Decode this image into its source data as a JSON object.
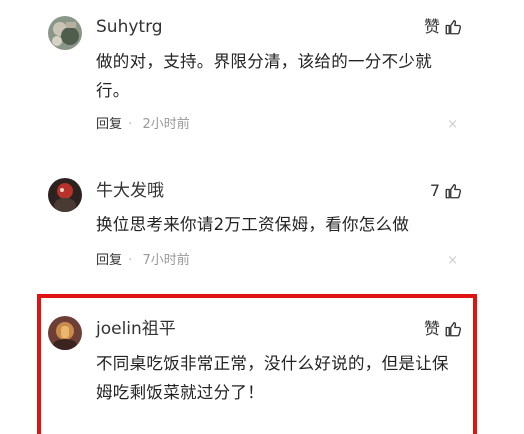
{
  "comments": [
    {
      "username": "Suhytrg",
      "like_label": "赞",
      "content": "做的对，支持。界限分清，该给的一分不少就行。",
      "reply_label": "回复",
      "separator": "·",
      "time": "2小时前",
      "close": "×",
      "avatar_colors": [
        "#6b7b6a",
        "#a6a39a",
        "#3d4a3f"
      ]
    },
    {
      "username": "牛大发哦",
      "like_label": "7",
      "content": "换位思考来你请2万工资保姆，看你怎么做",
      "reply_label": "回复",
      "separator": "·",
      "time": "7小时前",
      "close": "×",
      "avatar_colors": [
        "#3a2a25",
        "#c2302a",
        "#1a1512"
      ]
    },
    {
      "username": "joelin祖平",
      "like_label": "赞",
      "content": "不同桌吃饭非常正常，没什么好说的，但是让保姆吃剩饭菜就过分了！",
      "avatar_colors": [
        "#7a4a3e",
        "#e0a25a",
        "#3b2420"
      ]
    }
  ],
  "colors": {
    "highlight": "#e01313"
  },
  "icons": {
    "like": "thumbs-up-icon",
    "close": "close-icon"
  }
}
